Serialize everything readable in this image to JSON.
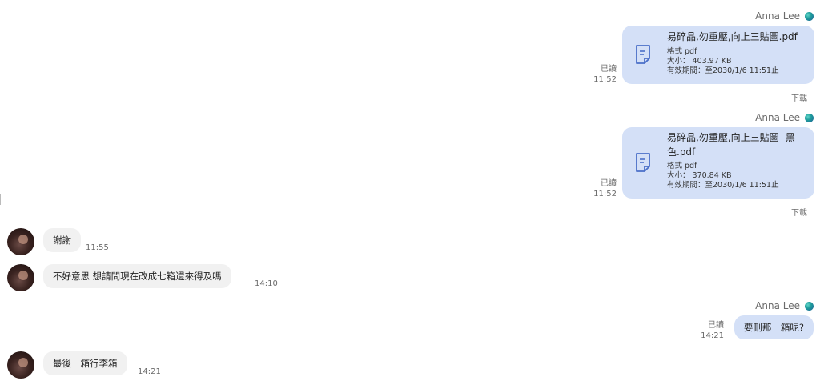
{
  "messages": {
    "file1": {
      "sender": "Anna Lee",
      "name": "易碎品,勿重壓,向上三貼圖.pdf",
      "format": "格式 pdf",
      "size": "大小： 403.97 KB",
      "expiry": "有效期間：至2030/1/6 11:51止",
      "read": "已讀",
      "time": "11:52",
      "download": "下載"
    },
    "file2": {
      "sender": "Anna Lee",
      "name_line1": "易碎品,勿重壓,向上三貼圖 -黑",
      "name_line2": "色.pdf",
      "format": "格式 pdf",
      "size": "大小： 370.84 KB",
      "expiry": "有效期間：至2030/1/6 11:51止",
      "read": "已讀",
      "time": "11:52",
      "download": "下載"
    },
    "in1": {
      "text": "謝謝",
      "time": "11:55"
    },
    "in2": {
      "text": "不好意思 想請問現在改成七箱還來得及嗎",
      "time": "14:10"
    },
    "out1": {
      "sender": "Anna Lee",
      "text": "要刪那一箱呢?",
      "read": "已讀",
      "time": "14:21"
    },
    "in3": {
      "text": "最後一箱行李箱",
      "time": "14:21"
    }
  },
  "colors": {
    "outgoing_bubble": "#d4e0f7",
    "incoming_bubble": "#f1f1f1",
    "meta_text": "#6b6b6b"
  },
  "icons": {
    "file": "document-icon",
    "status": "online-dot-icon"
  }
}
